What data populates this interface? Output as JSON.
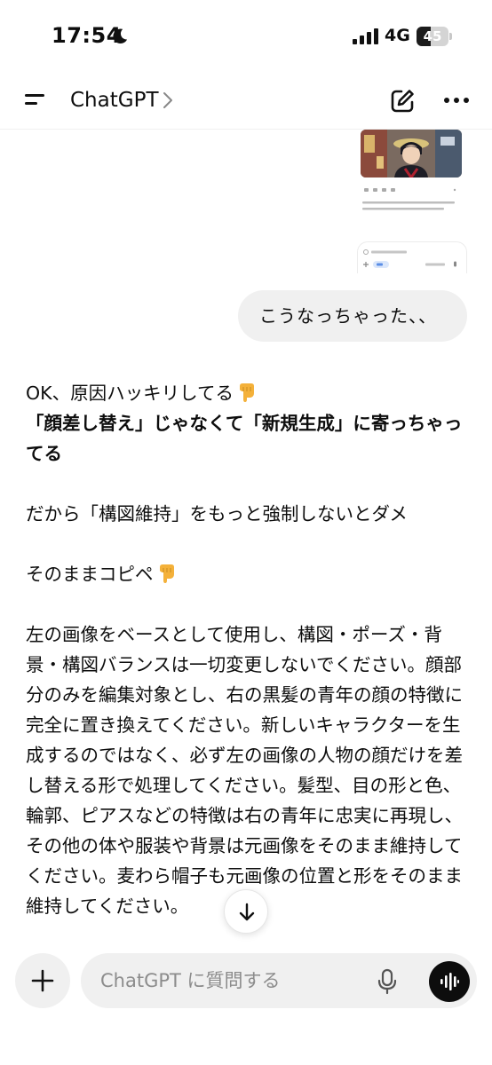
{
  "status_bar": {
    "time": "17:54",
    "network": "4G",
    "battery_level": "45",
    "battery_fraction": 0.45,
    "icons": [
      "moon-icon",
      "signal-icon",
      "battery-icon"
    ]
  },
  "header": {
    "title": "ChatGPT",
    "icons": [
      "menu-icon",
      "chevron-right-icon",
      "new-chat-icon",
      "more-icon"
    ]
  },
  "messages": {
    "user": {
      "text": "こうなっちゃった、、"
    },
    "assistant": {
      "line1": "OK、原因ハッキリしてる",
      "bold_line": "「顔差し替え」じゃなくて「新規生成」に寄っちゃってる",
      "line2": "だから「構図維持」をもっと強制しないとダメ",
      "line3": "そのままコピペ",
      "prompt_text": "左の画像をベースとして使用し、構図・ポーズ・背景・構図バランスは一切変更しないでください。顔部分のみを編集対象とし、右の黒髪の青年の顔の特徴に完全に置き換えてください。新しいキャラクターを生成するのではなく、必ず左の画像の人物の顔だけを差し替える形で処理してください。髪型、目の形と色、輪郭、ピアスなどの特徴は右の青年に忠実に再現し、その他の体や服装や背景は元画像をそのまま維持してください。麦わら帽子も元画像の位置と形をそのまま維持してください。",
      "emoji_icon": "pointing-down-icon"
    }
  },
  "composer": {
    "placeholder": "ChatGPT に質問する",
    "icons": [
      "plus-icon",
      "mic-icon",
      "waveform-icon"
    ]
  },
  "colors": {
    "bubble": "#f0f0f0",
    "text": "#0d0d0d",
    "placeholder": "#8c8c8c",
    "voice_button": "#0d0d0d"
  }
}
